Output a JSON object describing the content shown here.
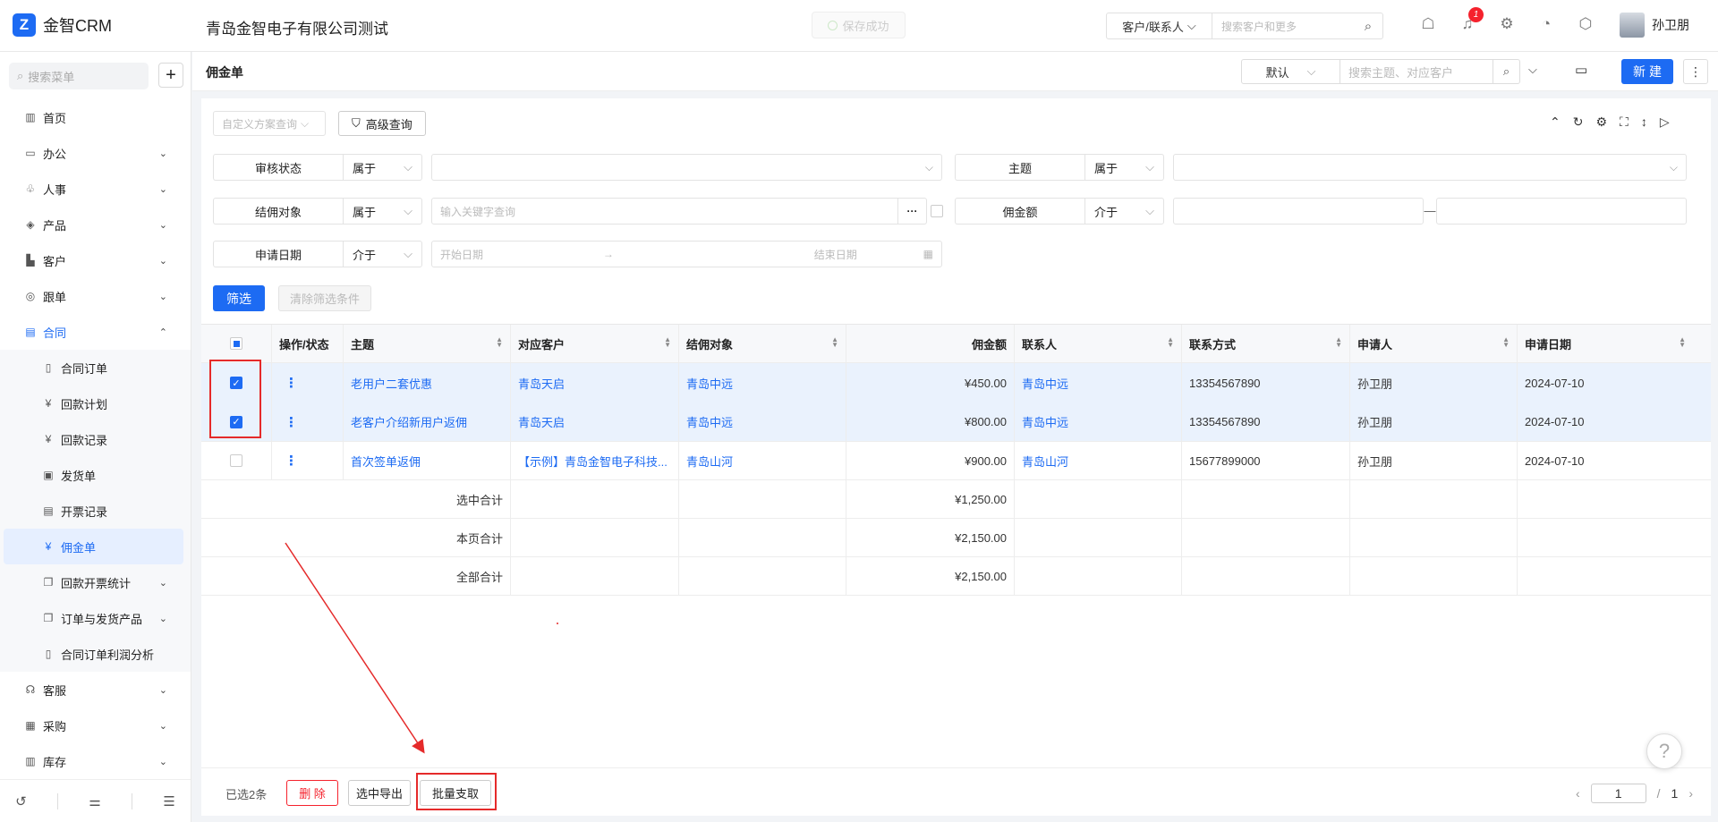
{
  "app": {
    "logo_mark": "Z",
    "name": "金智CRM",
    "company": "青岛金智电子有限公司测试",
    "saved_toast": "保存成功"
  },
  "global_search": {
    "scope": "客户/联系人",
    "placeholder": "搜索客户和更多"
  },
  "notifications": {
    "count": "1"
  },
  "user": {
    "name": "孙卫朋"
  },
  "sidebar": {
    "search_placeholder": "搜索菜单",
    "add_label": "+",
    "items": [
      {
        "label": "首页",
        "icon": "home-icon"
      },
      {
        "label": "办公",
        "icon": "office-icon"
      },
      {
        "label": "人事",
        "icon": "people-icon"
      },
      {
        "label": "产品",
        "icon": "box-icon"
      },
      {
        "label": "客户",
        "icon": "building-icon"
      },
      {
        "label": "跟单",
        "icon": "target-icon"
      },
      {
        "label": "合同",
        "icon": "contract-icon"
      }
    ],
    "contract_sub": [
      {
        "label": "合同订单",
        "icon": "file-icon"
      },
      {
        "label": "回款计划",
        "icon": "money-icon"
      },
      {
        "label": "回款记录",
        "icon": "money-icon"
      },
      {
        "label": "发货单",
        "icon": "truck-icon"
      },
      {
        "label": "开票记录",
        "icon": "invoice-icon"
      },
      {
        "label": "佣金单",
        "icon": "money-icon"
      },
      {
        "label": "回款开票统计",
        "icon": "copy-icon"
      },
      {
        "label": "订单与发货产品",
        "icon": "copy-icon"
      },
      {
        "label": "合同订单利润分析",
        "icon": "file-icon"
      }
    ],
    "items_after": [
      {
        "label": "客服",
        "icon": "headset-icon"
      },
      {
        "label": "采购",
        "icon": "bag-icon"
      },
      {
        "label": "库存",
        "icon": "warehouse-icon"
      }
    ]
  },
  "page": {
    "title": "佣金单",
    "view": "默认",
    "search_placeholder": "搜索主题、对应客户",
    "new_label": "新建"
  },
  "filters": {
    "custom_placeholder": "自定义方案查询",
    "advanced_label": "高级查询",
    "rows": {
      "audit": {
        "label": "审核状态",
        "op": "属于"
      },
      "subject": {
        "label": "主题",
        "op": "属于"
      },
      "target": {
        "label": "结佣对象",
        "op": "属于",
        "placeholder": "输入关键字查询"
      },
      "amount": {
        "label": "佣金额",
        "op": "介于",
        "sep": "—"
      },
      "date": {
        "label": "申请日期",
        "op": "介于",
        "start": "开始日期",
        "arrow": "→",
        "end": "结束日期"
      }
    },
    "filter_btn": "筛选",
    "clear_btn": "清除筛选条件"
  },
  "table": {
    "columns": [
      "操作/状态",
      "主题",
      "对应客户",
      "结佣对象",
      "佣金额",
      "联系人",
      "联系方式",
      "申请人",
      "申请日期"
    ],
    "rows": [
      {
        "subject": "老用户二套优惠",
        "customer": "青岛天启",
        "target": "青岛中远",
        "amount": "¥450.00",
        "contact": "青岛中远",
        "phone": "13354567890",
        "applicant": "孙卫朋",
        "date": "2024-07-10",
        "checked": true
      },
      {
        "subject": "老客户介绍新用户返佣",
        "customer": "青岛天启",
        "target": "青岛中远",
        "amount": "¥800.00",
        "contact": "青岛中远",
        "phone": "13354567890",
        "applicant": "孙卫朋",
        "date": "2024-07-10",
        "checked": true
      },
      {
        "subject": "首次签单返佣",
        "customer": "【示例】青岛金智电子科技...",
        "target": "青岛山河",
        "amount": "¥900.00",
        "contact": "青岛山河",
        "phone": "15677899000",
        "applicant": "孙卫朋",
        "date": "2024-07-10",
        "checked": false
      }
    ],
    "summaries": [
      {
        "label": "选中合计",
        "amount": "¥1,250.00"
      },
      {
        "label": "本页合计",
        "amount": "¥2,150.00"
      },
      {
        "label": "全部合计",
        "amount": "¥2,150.00"
      }
    ],
    "kebab": "⋮"
  },
  "footer": {
    "selected": "已选2条",
    "delete_label": "删 除",
    "export_label": "选中导出",
    "batch_label": "批量支取",
    "page_current": "1",
    "page_sep": "/",
    "page_total": "1"
  },
  "help_label": "?"
}
